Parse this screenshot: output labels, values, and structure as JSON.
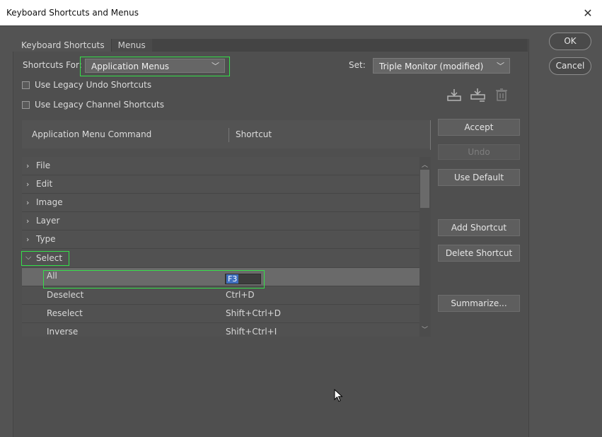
{
  "window": {
    "title": "Keyboard Shortcuts and Menus",
    "close_glyph": "✕"
  },
  "tabs": [
    {
      "label": "Keyboard Shortcuts"
    },
    {
      "label": "Menus"
    }
  ],
  "shortcuts_for": {
    "label": "Shortcuts For:",
    "value": "Application Menus"
  },
  "set": {
    "label": "Set:",
    "value": "Triple Monitor (modified)"
  },
  "checkboxes": [
    {
      "label": "Use Legacy Undo Shortcuts",
      "checked": false
    },
    {
      "label": "Use Legacy Channel Shortcuts",
      "checked": false
    }
  ],
  "table": {
    "col_command": "Application Menu Command",
    "col_shortcut": "Shortcut",
    "groups": [
      {
        "label": "File"
      },
      {
        "label": "Edit"
      },
      {
        "label": "Image"
      },
      {
        "label": "Layer"
      },
      {
        "label": "Type"
      },
      {
        "label": "Select"
      }
    ],
    "items": [
      {
        "command": "All",
        "shortcut": "F3"
      },
      {
        "command": "Deselect",
        "shortcut": "Ctrl+D"
      },
      {
        "command": "Reselect",
        "shortcut": "Shift+Ctrl+D"
      },
      {
        "command": "Inverse",
        "shortcut": "Shift+Ctrl+I"
      }
    ]
  },
  "side_buttons": {
    "accept": "Accept",
    "undo": "Undo",
    "use_default": "Use Default",
    "add_shortcut": "Add Shortcut",
    "delete_shortcut": "Delete Shortcut",
    "summarize": "Summarize..."
  },
  "dialog_buttons": {
    "ok": "OK",
    "cancel": "Cancel"
  },
  "colors": {
    "highlight": "#35e04a",
    "selection": "#3f6fbf"
  }
}
